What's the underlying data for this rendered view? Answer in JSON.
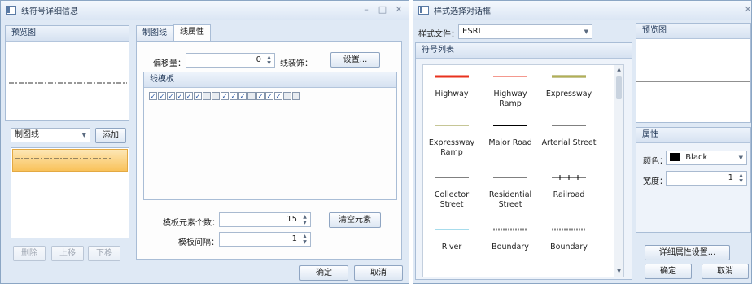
{
  "left": {
    "title": "线符号详细信息",
    "preview_header": "预览图",
    "dropdown_value": "制图线",
    "add_button": "添加",
    "delete_button": "删除",
    "up_button": "上移",
    "down_button": "下移",
    "tabs": [
      "制图线",
      "线属性"
    ],
    "offset_label": "偏移量：",
    "offset_value": "0",
    "decoration_label": "线装饰：",
    "settings_button": "设置...",
    "template_header": "线模板",
    "template_checks": [
      true,
      true,
      true,
      true,
      true,
      true,
      false,
      false,
      true,
      true,
      true,
      false,
      true,
      true,
      true,
      false,
      false
    ],
    "element_count_label": "模板元素个数：",
    "element_count_value": "15",
    "clear_button": "清空元素",
    "interval_label": "模板间隔：",
    "interval_value": "1",
    "ok_button": "确定",
    "cancel_button": "取消"
  },
  "right": {
    "title": "样式选择对话框",
    "style_file_label": "样式文件：",
    "style_file_value": "ESRI",
    "symbol_list_header": "符号列表",
    "symbols": [
      {
        "name": "Highway",
        "color": "#e8321e"
      },
      {
        "name": "Highway Ramp",
        "color": "#e8321e"
      },
      {
        "name": "Expressway",
        "color": "#8e8c2e"
      },
      {
        "name": "Expressway Ramp",
        "color": "#8e8c2e"
      },
      {
        "name": "Major Road",
        "color": "#000000"
      },
      {
        "name": "Arterial Street",
        "color": "#000000"
      },
      {
        "name": "Collector Street",
        "color": "#000000"
      },
      {
        "name": "Residential Street",
        "color": "#000000"
      },
      {
        "name": "Railroad",
        "color": "#000000"
      },
      {
        "name": "River",
        "color": "#4fb8d8"
      },
      {
        "name": "Boundary",
        "color": "#8a8a8a"
      },
      {
        "name": "Boundary",
        "color": "#8a8a8a"
      }
    ],
    "preview_header": "预览图",
    "properties_header": "属性",
    "color_label": "颜色：",
    "color_value": "Black",
    "color_swatch": "#000000",
    "width_label": "宽度：",
    "width_value": "1",
    "detail_button": "详细属性设置...",
    "ok_button": "确定",
    "cancel_button": "取消"
  }
}
